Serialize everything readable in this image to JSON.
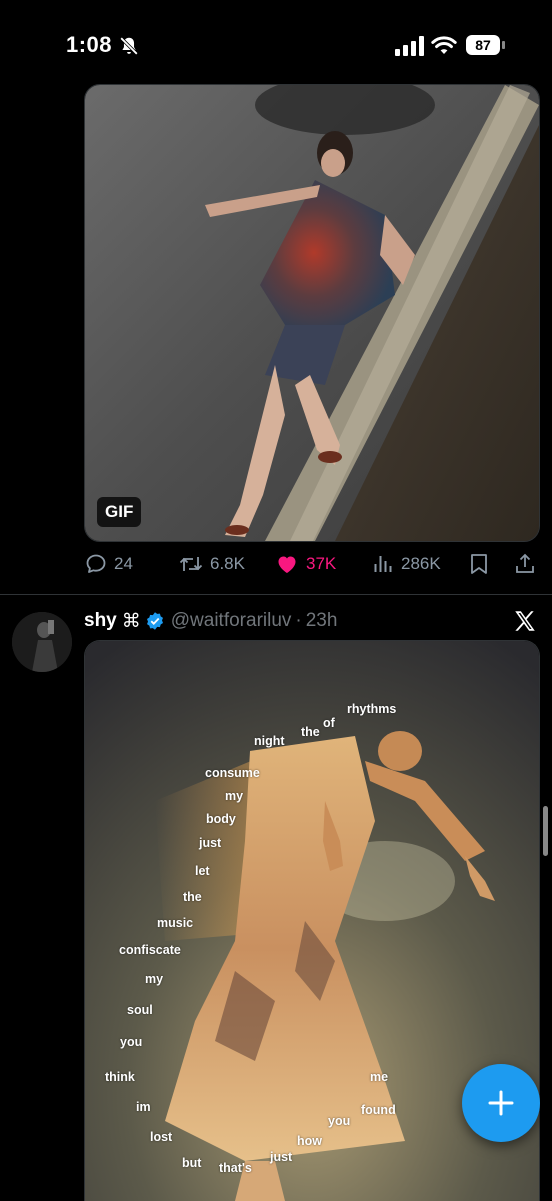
{
  "status_bar": {
    "time": "1:08",
    "battery": "87"
  },
  "tweet1": {
    "media_badge": "GIF",
    "reply_count": "24",
    "retweet_count": "6.8K",
    "like_count": "37K",
    "view_count": "286K",
    "liked": true
  },
  "tweet2": {
    "name": "shy",
    "name_symbol": "⌘",
    "handle": "@waitforariluv",
    "separator": "·",
    "time": "23h",
    "verified": true,
    "image_words": {
      "rhythms": "rhythms",
      "of": "of",
      "the": "the",
      "night": "night",
      "consume": "consume",
      "my1": "my",
      "body": "body",
      "just1": "just",
      "let": "let",
      "the2": "the",
      "music": "music",
      "confiscate": "confiscate",
      "my2": "my",
      "soul": "soul",
      "you1": "you",
      "think": "think",
      "im": "im",
      "lost": "lost",
      "but": "but",
      "thats": "that's",
      "just2": "just",
      "how": "how",
      "you2": "you",
      "found": "found",
      "me": "me"
    }
  },
  "colors": {
    "background": "#000000",
    "accent_blue": "#1d9bf0",
    "like_pink": "#f91880",
    "muted_text": "#71767b",
    "action_gray": "#8b98a5"
  },
  "icons": [
    "bell-slash-icon",
    "cellular-signal-icon",
    "wifi-icon",
    "battery-icon",
    "reply-icon",
    "retweet-icon",
    "heart-icon",
    "views-icon",
    "bookmark-icon",
    "share-icon",
    "verified-badge-icon",
    "x-logo-icon",
    "compose-plus-icon"
  ]
}
